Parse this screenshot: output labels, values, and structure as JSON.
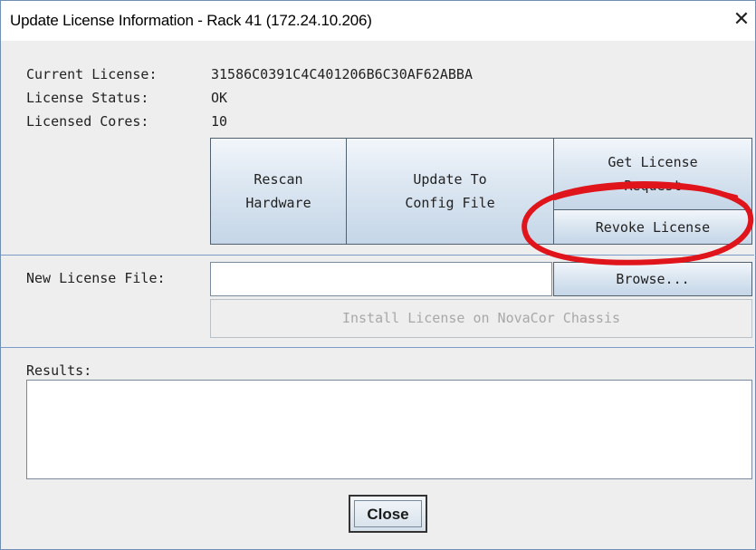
{
  "window": {
    "title": "Update License Information - Rack 41 (172.24.10.206)",
    "close_glyph": "✕"
  },
  "license_info": {
    "current_license_label": "Current License:",
    "current_license_value": "31586C0391C4C401206B6C30AF62ABBA",
    "status_label": "License Status:",
    "status_value": "OK",
    "cores_label": "Licensed Cores:",
    "cores_value": "10"
  },
  "actions": {
    "rescan_line1": "Rescan",
    "rescan_line2": "Hardware",
    "update_line1": "Update To",
    "update_line2": "Config File",
    "get_request_line1": "Get License",
    "get_request_line2": "Request",
    "revoke_label": "Revoke License"
  },
  "new_license": {
    "label": "New License File:",
    "value": "",
    "browse_label": "Browse...",
    "install_label": "Install License on NovaCor Chassis"
  },
  "results": {
    "label": "Results:",
    "text": ""
  },
  "footer": {
    "close_label": "Close"
  },
  "annotation": {
    "highlight_color": "#e0141b",
    "target": "revoke-license-button"
  },
  "icons": [
    "close-icon"
  ]
}
